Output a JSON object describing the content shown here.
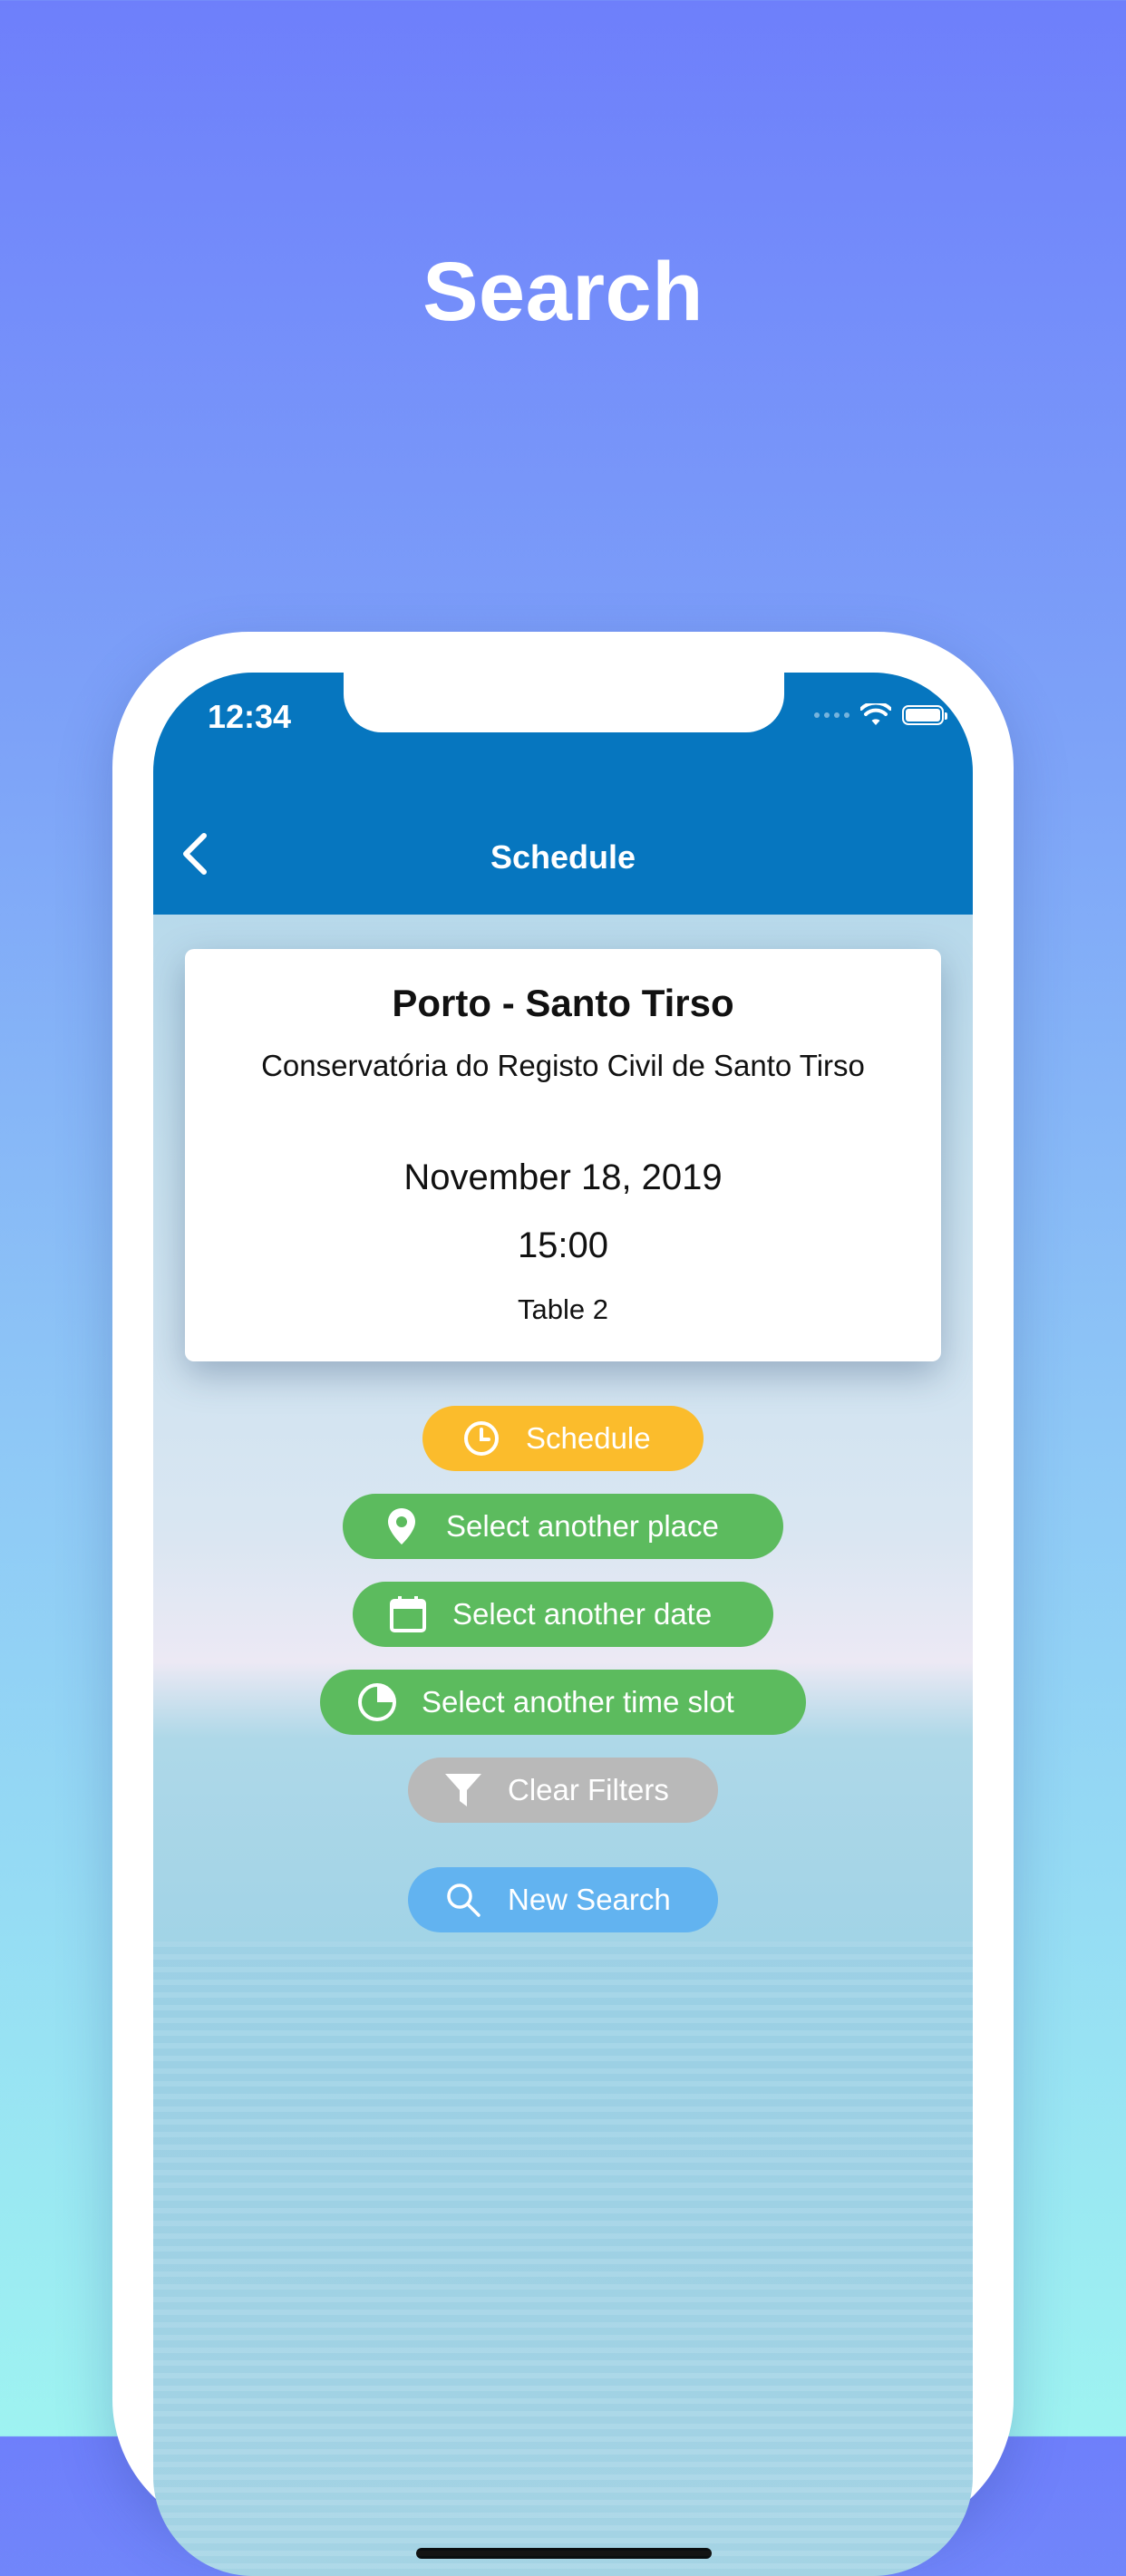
{
  "hero": {
    "title": "Search"
  },
  "status_bar": {
    "time": "12:34"
  },
  "nav": {
    "title": "Schedule"
  },
  "card": {
    "place": "Porto - Santo Tirso",
    "office": "Conservatória do Registo Civil de Santo Tirso",
    "date": "November 18, 2019",
    "time": "15:00",
    "table": "Table 2"
  },
  "actions": {
    "schedule": "Schedule",
    "select_place": "Select another place",
    "select_date": "Select another date",
    "select_time": "Select another time slot",
    "clear_filters": "Clear Filters",
    "new_search": "New Search"
  },
  "colors": {
    "app_bar": "#0676bf",
    "schedule_button": "#fbbc2c",
    "select_buttons": "#5cbb5e",
    "clear_button": "#b9b9b9",
    "new_search_button": "#62b3f0"
  },
  "icons": {
    "back": "chevron-left-icon",
    "schedule": "clock-icon",
    "place": "map-pin-icon",
    "date": "calendar-icon",
    "time_slot": "pie-chart-icon",
    "clear": "filter-icon",
    "search": "search-icon"
  }
}
